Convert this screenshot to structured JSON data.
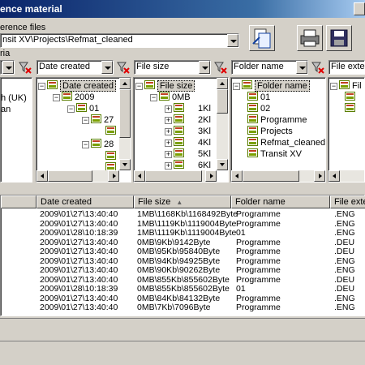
{
  "window": {
    "title": "ence material"
  },
  "ref_files": {
    "label": "erence files",
    "path": "nsit XV\\Projects\\Refmat_cleaned"
  },
  "criteria": {
    "label": "ria",
    "combos": [
      {
        "value": ""
      },
      {
        "value": "Date created"
      },
      {
        "value": "File size"
      },
      {
        "value": "Folder name"
      },
      {
        "value": "File extens"
      }
    ]
  },
  "tree0": {
    "items": [
      "h (UK)",
      "an"
    ]
  },
  "tree1": {
    "items": [
      "Date created",
      "2009",
      "01",
      "27",
      "28"
    ]
  },
  "tree2": {
    "items": [
      "File size",
      "0MB",
      "1Kl",
      "2Kl",
      "3Kl",
      "4Kl",
      "5Kl",
      "6Kl"
    ]
  },
  "tree3": {
    "items": [
      "Folder name",
      "01",
      "02",
      "Programme",
      "Projects",
      "Refmat_cleaned",
      "Transit XV"
    ]
  },
  "tree4": {
    "items": [
      "Fil"
    ]
  },
  "grid": {
    "headers": [
      "",
      "Date created",
      "File size",
      "Folder name",
      "File extens"
    ],
    "sort_indicator": "▲",
    "rows": [
      [
        "2009\\01\\27\\13:40:40",
        "1MB\\1168Kb\\1168492Byte",
        "Programme",
        ".ENG"
      ],
      [
        "2009\\01\\27\\13:40:40",
        "1MB\\1119Kb\\1119004Byte",
        "Programme",
        ".ENG"
      ],
      [
        "2009\\01\\28\\10:18:39",
        "1MB\\1119Kb\\1119004Byte",
        "01",
        ".ENG"
      ],
      [
        "2009\\01\\27\\13:40:40",
        "0MB\\9Kb\\9142Byte",
        "Programme",
        ".DEU"
      ],
      [
        "2009\\01\\27\\13:40:40",
        "0MB\\95Kb\\95840Byte",
        "Programme",
        ".DEU"
      ],
      [
        "2009\\01\\27\\13:40:40",
        "0MB\\94Kb\\94925Byte",
        "Programme",
        ".ENG"
      ],
      [
        "2009\\01\\27\\13:40:40",
        "0MB\\90Kb\\90262Byte",
        "Programme",
        ".ENG"
      ],
      [
        "2009\\01\\27\\13:40:40",
        "0MB\\855Kb\\855602Byte",
        "Programme",
        ".DEU"
      ],
      [
        "2009\\01\\28\\10:18:39",
        "0MB\\855Kb\\855602Byte",
        "01",
        ".DEU"
      ],
      [
        "2009\\01\\27\\13:40:40",
        "0MB\\84Kb\\84132Byte",
        "Programme",
        ".ENG"
      ],
      [
        "2009\\01\\27\\13:40:40",
        "0MB\\7Kb\\7096Byte",
        "Programme",
        ".ENG"
      ]
    ]
  }
}
